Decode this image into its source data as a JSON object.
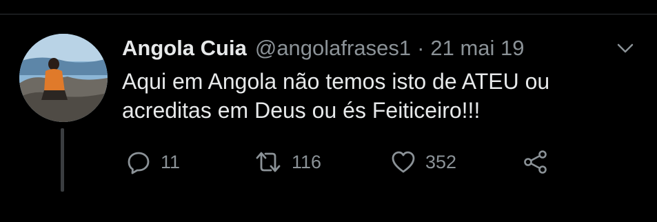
{
  "tweet": {
    "author_name": "Angola Cuia",
    "author_handle": "@angolafrases1",
    "separator": "·",
    "date": "21 mai 19",
    "text_lines": [
      "Aqui em Angola não temos isto de ATEU ou",
      "acreditas em Deus ou és Feiticeiro!!!"
    ]
  },
  "actions": {
    "reply": {
      "icon": "reply-icon",
      "count": "11"
    },
    "retweet": {
      "icon": "retweet-icon",
      "count": "116"
    },
    "like": {
      "icon": "heart-icon",
      "count": "352"
    },
    "share": {
      "icon": "share-icon"
    }
  },
  "menu": {
    "icon": "chevron-down-icon"
  },
  "colors": {
    "background": "#000000",
    "primary_text": "#e7e9ea",
    "secondary_text": "#8b9297",
    "divider": "#2f3336"
  }
}
